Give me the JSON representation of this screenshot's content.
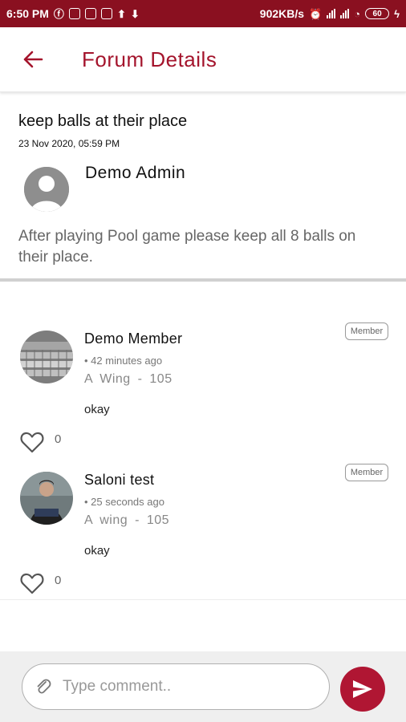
{
  "status_bar": {
    "time": "6:50 PM",
    "network_speed": "902KB/s",
    "battery": "60"
  },
  "app_bar": {
    "title": "Forum Details"
  },
  "post": {
    "title": "keep balls at their place",
    "date": "23 Nov 2020, 05:59 PM",
    "author": "Demo  Admin",
    "body": "After playing Pool game please keep all 8 balls on their place."
  },
  "comments": [
    {
      "name": "Demo  Member",
      "time": "42 minutes ago",
      "location": "A Wing  -  105",
      "text": "okay",
      "badge": "Member",
      "likes": "0"
    },
    {
      "name": "Saloni  test",
      "time": "25 seconds ago",
      "location": "A wing  -  105",
      "text": "okay",
      "badge": "Member",
      "likes": "0"
    }
  ],
  "composer": {
    "placeholder": "Type comment..",
    "value": ""
  },
  "colors": {
    "status_bar": "#8a1020",
    "accent": "#a4142c",
    "send_button": "#b01633"
  },
  "icons": {
    "back": "arrow-left-icon",
    "like": "heart-outline-icon",
    "attach": "paperclip-icon",
    "send": "send-icon"
  }
}
